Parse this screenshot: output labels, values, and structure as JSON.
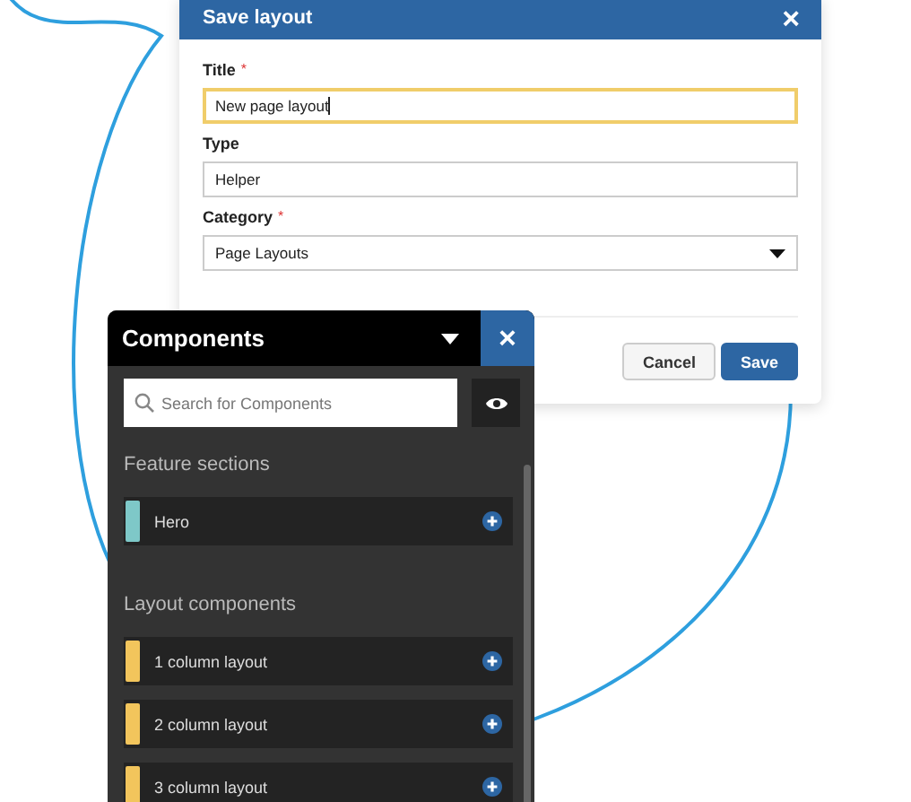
{
  "dialog": {
    "title": "Save layout",
    "close": "×",
    "fields": [
      {
        "label": "Title",
        "required_mark": "*",
        "kind": "text",
        "value": "New page layout",
        "focused": true
      },
      {
        "label": "Type",
        "kind": "text",
        "value": "Helper",
        "focused": false
      },
      {
        "label": "Category",
        "required_mark": "*",
        "kind": "select",
        "value": "Page Layouts",
        "focused": false
      }
    ],
    "buttons": [
      {
        "label": "Cancel",
        "primary": false
      },
      {
        "label": "Save",
        "primary": true
      }
    ]
  },
  "panel": {
    "title": "Components",
    "close": "×",
    "search": {
      "placeholder": "Search for Components"
    },
    "sections": [
      {
        "heading": "Feature sections",
        "items": [
          {
            "label": "Hero",
            "color": "#7ec8c8"
          }
        ]
      },
      {
        "heading": "Layout components",
        "items": [
          {
            "label": "1 column layout",
            "color": "#f2c55c"
          },
          {
            "label": "2 column layout",
            "color": "#f2c55c"
          },
          {
            "label": "3 column layout",
            "color": "#f2c55c"
          }
        ]
      }
    ]
  }
}
